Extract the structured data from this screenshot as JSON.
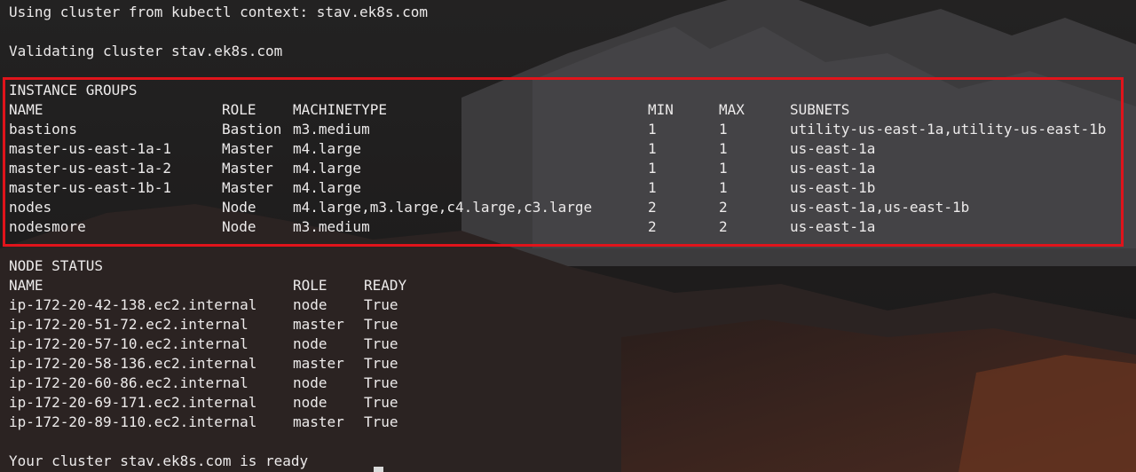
{
  "terminal": {
    "using_line": "Using cluster from kubectl context: stav.ek8s.com",
    "validating_line": "Validating cluster stav.ek8s.com",
    "instance_groups": {
      "heading": "INSTANCE GROUPS",
      "columns": {
        "name": "NAME",
        "role": "ROLE",
        "machinetype": "MACHINETYPE",
        "min": "MIN",
        "max": "MAX",
        "subnets": "SUBNETS"
      },
      "rows": [
        {
          "name": "bastions",
          "role": "Bastion",
          "machinetype": "m3.medium",
          "min": "1",
          "max": "1",
          "subnets": "utility-us-east-1a,utility-us-east-1b"
        },
        {
          "name": "master-us-east-1a-1",
          "role": "Master",
          "machinetype": "m4.large",
          "min": "1",
          "max": "1",
          "subnets": "us-east-1a"
        },
        {
          "name": "master-us-east-1a-2",
          "role": "Master",
          "machinetype": "m4.large",
          "min": "1",
          "max": "1",
          "subnets": "us-east-1a"
        },
        {
          "name": "master-us-east-1b-1",
          "role": "Master",
          "machinetype": "m4.large",
          "min": "1",
          "max": "1",
          "subnets": "us-east-1b"
        },
        {
          "name": "nodes",
          "role": "Node",
          "machinetype": "m4.large,m3.large,c4.large,c3.large",
          "min": "2",
          "max": "2",
          "subnets": "us-east-1a,us-east-1b"
        },
        {
          "name": "nodesmore",
          "role": "Node",
          "machinetype": "m3.medium",
          "min": "2",
          "max": "2",
          "subnets": "us-east-1a"
        }
      ]
    },
    "node_status": {
      "heading": "NODE STATUS",
      "columns": {
        "name": "NAME",
        "role": "ROLE",
        "ready": "READY"
      },
      "rows": [
        {
          "name": "ip-172-20-42-138.ec2.internal",
          "role": "node",
          "ready": "True"
        },
        {
          "name": "ip-172-20-51-72.ec2.internal",
          "role": "master",
          "ready": "True"
        },
        {
          "name": "ip-172-20-57-10.ec2.internal",
          "role": "node",
          "ready": "True"
        },
        {
          "name": "ip-172-20-58-136.ec2.internal",
          "role": "master",
          "ready": "True"
        },
        {
          "name": "ip-172-20-60-86.ec2.internal",
          "role": "node",
          "ready": "True"
        },
        {
          "name": "ip-172-20-69-171.ec2.internal",
          "role": "node",
          "ready": "True"
        },
        {
          "name": "ip-172-20-89-110.ec2.internal",
          "role": "master",
          "ready": "True"
        }
      ]
    },
    "ready_line": "Your cluster stav.ek8s.com is ready"
  },
  "colors": {
    "text": "#eceaea",
    "highlight_border": "#e0141b",
    "background": "#1b1818"
  }
}
